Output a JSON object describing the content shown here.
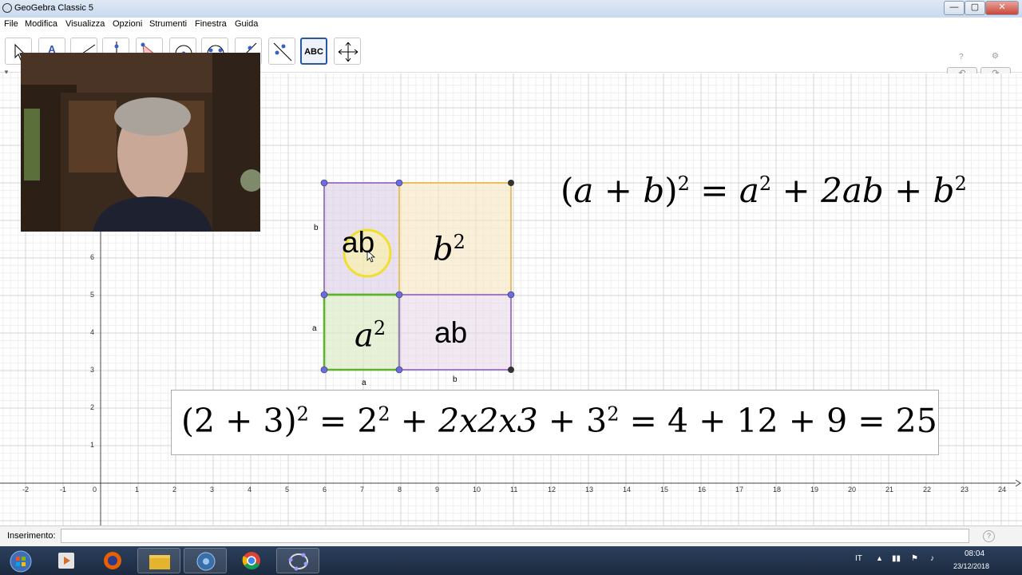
{
  "window": {
    "title": "GeoGebra Classic 5",
    "minimize": "—",
    "maximize": "▢",
    "close": "✕"
  },
  "menu": [
    "File",
    "Modifica",
    "Visualizza",
    "Opzioni",
    "Strumenti",
    "Finestra",
    "Guida"
  ],
  "toolbar": {
    "tools": [
      {
        "name": "move-tool-icon"
      },
      {
        "name": "text-a-tool-icon",
        "label": "A"
      },
      {
        "name": "line-tool-icon"
      },
      {
        "name": "perpendicular-tool-icon"
      },
      {
        "name": "polygon-tool-icon"
      },
      {
        "name": "circle-tool-icon"
      },
      {
        "name": "circle-three-points-tool-icon"
      },
      {
        "name": "angle-tool-icon"
      },
      {
        "name": "reflect-tool-icon"
      },
      {
        "name": "text-tool-icon",
        "label": "ABC"
      },
      {
        "name": "move-graphics-tool-icon"
      }
    ],
    "undo": "↶",
    "redo": "↷",
    "help": "?",
    "settings": "⚙"
  },
  "graph": {
    "x_ticks": [
      "-2",
      "-1",
      "0",
      "1",
      "2",
      "3",
      "4",
      "5",
      "6",
      "7",
      "8",
      "9",
      "10",
      "11",
      "12",
      "13",
      "14",
      "15",
      "16",
      "17",
      "18",
      "19",
      "20",
      "21",
      "22",
      "23",
      "24"
    ],
    "y_ticks": [
      "1",
      "2",
      "3",
      "4",
      "5",
      "6"
    ],
    "side_labels": {
      "a_left": "a",
      "b_left": "b",
      "a_bottom": "a",
      "b_bottom": "b"
    },
    "region_labels": {
      "ab_top": "ab",
      "b2": "b",
      "b2_exp": "2",
      "a2": "a",
      "a2_exp": "2",
      "ab_bottom": "ab"
    },
    "colors": {
      "purple": "#9b6bbf",
      "gold": "#e8c062",
      "green": "#5cb32c",
      "grid": "#e3e3e3",
      "point_blue": "#6b6be8",
      "point_dark": "#333333"
    }
  },
  "formulas": {
    "identity": {
      "lhs_open": "(",
      "a": "a",
      "plus": "+",
      "b": "b",
      "lhs_close": ")",
      "exp": "2",
      "eq": "=",
      "a2": "a",
      "a2_exp": "2",
      "plus2": "+",
      "two_ab": "2ab",
      "plus3": "+",
      "b2": "b",
      "b2_exp": "2"
    },
    "numeric": {
      "lhs": "(2 + 3)",
      "exp1": "2",
      "eq1": "=",
      "t1": "2",
      "e1": "2",
      "p1": "+",
      "t2": "2x2x3",
      "p2": "+",
      "t3": "3",
      "e3": "2",
      "eq2": "=",
      "t4": "4",
      "p3": "+",
      "t5": "12",
      "p4": "+",
      "t6": "9",
      "eq3": "=",
      "t7": "25"
    }
  },
  "input_bar": {
    "label": "Inserimento:",
    "value": "",
    "help": "?"
  },
  "taskbar": {
    "apps": [
      "start-icon",
      "media-player-icon",
      "firefox-icon",
      "file-explorer-icon",
      "media-icon",
      "chrome-icon",
      "geogebra-icon"
    ],
    "lang": "IT",
    "time": "08:04",
    "date": "23/12/2018"
  }
}
